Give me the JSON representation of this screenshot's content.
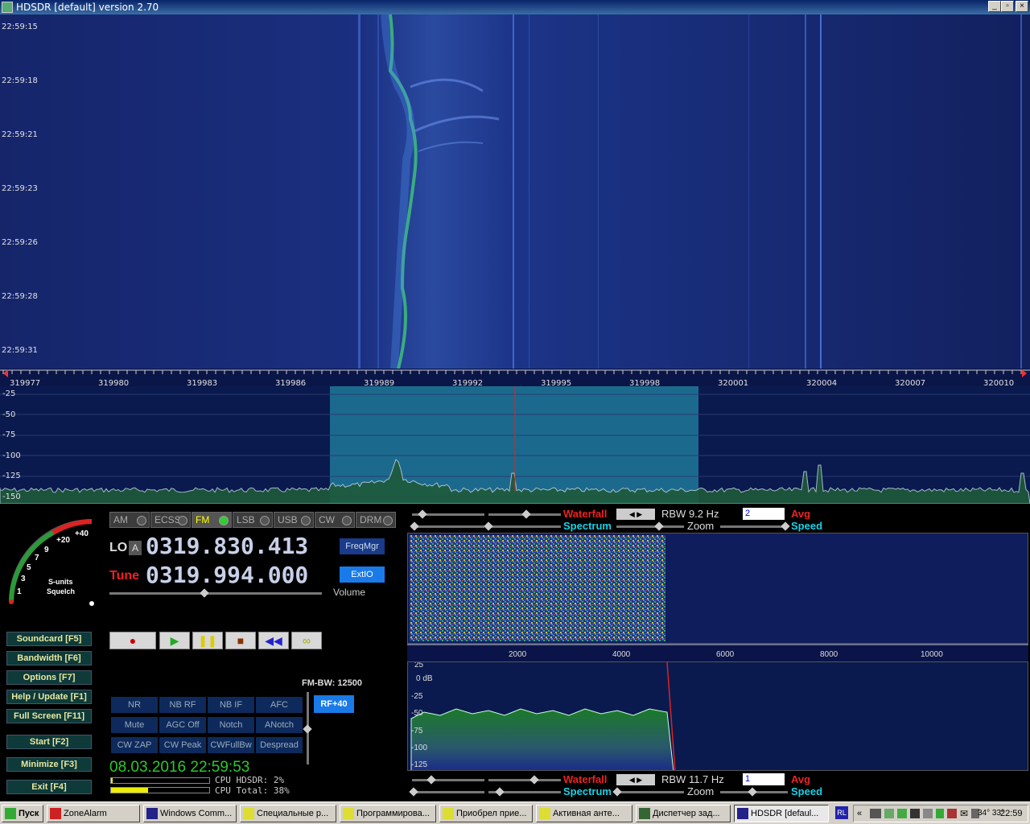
{
  "window": {
    "title": "HDSDR [default]  version 2.70"
  },
  "waterfall": {
    "times": [
      "22:59:15",
      "22:59:18",
      "22:59:21",
      "22:59:23",
      "22:59:26",
      "22:59:28",
      "22:59:31"
    ]
  },
  "freq_axis": {
    "labels": [
      "319977",
      "319980",
      "319983",
      "319986",
      "319989",
      "319992",
      "319995",
      "319998",
      "320001",
      "320004",
      "320007",
      "320010"
    ]
  },
  "spectrum": {
    "db_labels": [
      "-25",
      "-50",
      "-75",
      "-100",
      "-125",
      "-150"
    ]
  },
  "smeter": {
    "labels": [
      "+40",
      "+20",
      "9",
      "7",
      "5",
      "3",
      "1"
    ],
    "caption1": "S-units",
    "caption2": "Squelch"
  },
  "modes": [
    "AM",
    "ECSS",
    "FM",
    "LSB",
    "USB",
    "CW",
    "DRM"
  ],
  "lo": {
    "label": "LO",
    "tag": "A",
    "value": "0319.830.413"
  },
  "tune": {
    "label": "Tune",
    "value": "0319.994.000"
  },
  "buttons": {
    "freqmgr": "FreqMgr",
    "extio": "ExtIO",
    "volume": "Volume",
    "rf": "RF+40",
    "fmbw": "FM-BW: 12500"
  },
  "side_buttons": [
    "Soundcard  [F5]",
    "Bandwidth  [F6]",
    "Options  [F7]",
    "Help / Update  [F1]",
    "Full Screen  [F11]",
    "Start  [F2]",
    "Minimize  [F3]",
    "Exit  [F4]"
  ],
  "func_buttons": [
    "NR",
    "NB RF",
    "NB IF",
    "AFC",
    "Mute",
    "AGC Off",
    "Notch",
    "ANotch",
    "CW ZAP",
    "CW Peak",
    "CWFullBw",
    "Despread"
  ],
  "datetime": "08.03.2016 22:59:53",
  "cpu": {
    "hdsdr": "CPU HDSDR: 2%",
    "total": "CPU Total: 38%"
  },
  "top_ctrl": {
    "waterfall": "Waterfall",
    "spectrum": "Spectrum",
    "zoom": "Zoom",
    "speed": "Speed",
    "rbw": "RBW  9.2 Hz",
    "avg_val": "2",
    "avg": "Avg"
  },
  "bottom_ctrl": {
    "waterfall": "Waterfall",
    "spectrum": "Spectrum",
    "zoom": "Zoom",
    "speed": "Speed",
    "rbw": "RBW  11.7 Hz",
    "avg_val": "1",
    "avg": "Avg"
  },
  "af_axis": {
    "labels": [
      "2000",
      "4000",
      "6000",
      "8000",
      "10000"
    ]
  },
  "af_db": {
    "labels": [
      "25",
      "0 dB",
      "-25",
      "-50",
      "-75",
      "-100",
      "-125"
    ]
  },
  "taskbar": {
    "start": "Пуск",
    "tasks": [
      "ZoneAlarm",
      "Windows Comm...",
      "Специальные р...",
      "Программирова...",
      "Приобрел прие...",
      "Активная анте...",
      "Диспетчер зад...",
      "HDSDR [defaul..."
    ],
    "lang": "RL",
    "temps": "34° 33°",
    "clock": "22:59"
  }
}
